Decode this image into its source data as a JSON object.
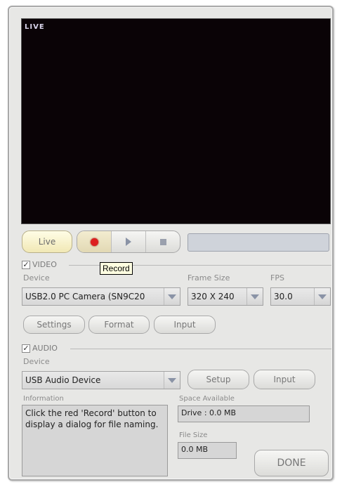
{
  "video_overlay": {
    "live_tag": "LIVE"
  },
  "controls": {
    "live_button": "Live",
    "record_tooltip": "Record"
  },
  "video_section": {
    "checkbox_label": "VIDEO",
    "checked": true,
    "device_label": "Device",
    "device_value": "USB2.0 PC Camera (SN9C20",
    "frame_size_label": "Frame Size",
    "frame_size_value": "320 X 240",
    "fps_label": "FPS",
    "fps_value": "30.0",
    "buttons": [
      "Settings",
      "Format",
      "Input"
    ]
  },
  "audio_section": {
    "checkbox_label": "AUDIO",
    "checked": true,
    "device_label": "Device",
    "device_value": "USB Audio Device",
    "setup_button": "Setup",
    "input_button": "Input"
  },
  "info": {
    "information_label": "Information",
    "information_text": "Click the red 'Record' button to display a dialog for file naming.",
    "space_label": "Space Available",
    "space_value": "Drive : 0.0 MB",
    "file_size_label": "File Size",
    "file_size_value": "0.0 MB"
  },
  "done_button": "DONE",
  "icons": [
    "record-icon",
    "play-icon",
    "stop-icon",
    "chevron-down-icon",
    "checkbox-icon"
  ]
}
